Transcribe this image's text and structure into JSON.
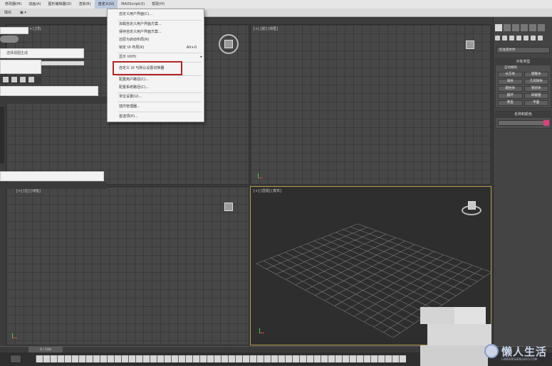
{
  "menubar": {
    "items": [
      "修改器(M)",
      "动画(A)",
      "图形编辑器(D)",
      "渲染(R)",
      "自定义(U)",
      "MAXScript(X)",
      "帮助(H)"
    ]
  },
  "toolstrip": {
    "items": [
      "填充",
      "▣ ▾"
    ]
  },
  "viewports": {
    "top_left": "[+] [顶]",
    "top_right": "[+] [前] [线框]",
    "bottom_left": "[+] [左] [线框]",
    "bottom_right": "[+] [透视] [真实]"
  },
  "left_panel": {
    "field_text": "选择视图生成"
  },
  "customize_menu": {
    "items": [
      {
        "label": "自定义用户界面(C)..."
      },
      {
        "label": "加载自定义用户界面方案..."
      },
      {
        "label": "保存自定义用户界面方案..."
      },
      {
        "label": "还原为启动布局(R)"
      },
      {
        "label": "锁定 UI 布局(K)",
        "shortcut": "Alt+0"
      },
      {
        "label": "显示 UI(H)",
        "arrow": "▸"
      },
      {
        "label": "自定义 UI 与默认设置切换器"
      },
      {
        "label": "配置用户路径(C)..."
      },
      {
        "label": "配置系统路径(C)..."
      },
      {
        "label": "单位设置(U)..."
      },
      {
        "label": "插件管理器..."
      },
      {
        "label": "首选项(P)..."
      }
    ]
  },
  "command_panel": {
    "dropdown": "标准基本体",
    "rollout1_title": "对象类型",
    "autogrid": "自动栅格",
    "buttons": [
      "长方体",
      "圆锥体",
      "球体",
      "几何球体",
      "圆柱体",
      "管状体",
      "圆环",
      "四棱锥",
      "茶壶",
      "平面"
    ],
    "rollout2_title": "名称和颜色",
    "swatch_color": "#d6437a"
  },
  "timeline": {
    "slider": "0 / 100"
  },
  "watermark": {
    "text": "懒人生活",
    "sub": "LANRENSHENGHUO.COM"
  },
  "colors": {
    "highlight_box": "#b32424",
    "viewport_bg": "#474747",
    "perspective_border": "#b59a4a"
  }
}
